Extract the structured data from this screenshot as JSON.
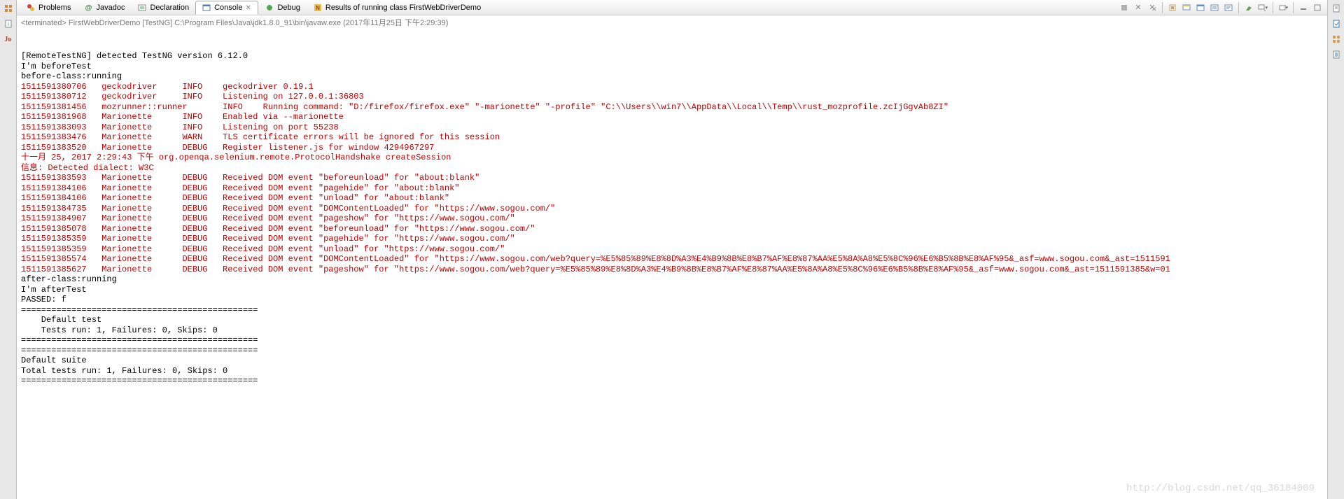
{
  "left_icons": [
    "outline-icon",
    "javadoc-icon",
    "ju-icon"
  ],
  "right_icons": [
    "outline-icon-r",
    "task-icon-r",
    "bookmark-icon-r",
    "notes-icon-r"
  ],
  "tabs": [
    {
      "label": "Problems",
      "icon": "problems-icon"
    },
    {
      "label": "Javadoc",
      "icon": "javadoc-tab-icon"
    },
    {
      "label": "Declaration",
      "icon": "declaration-icon"
    },
    {
      "label": "Console",
      "icon": "console-icon",
      "active": true,
      "closable": true
    },
    {
      "label": "Debug",
      "icon": "debug-icon"
    },
    {
      "label": "Results of running class FirstWebDriverDemo",
      "icon": "testng-icon"
    }
  ],
  "toolbar_right": [
    "terminate-icon",
    "remove-launch-icon",
    "remove-all-icon",
    "sep",
    "pin-icon",
    "display-icon",
    "open-console-icon",
    "scroll-lock-icon",
    "word-wrap-icon",
    "sep",
    "clear-icon",
    "minimize-icon",
    "sep",
    "new-console-icon",
    "sep",
    "min-view-icon",
    "max-view-icon"
  ],
  "sub_header": "<terminated> FirstWebDriverDemo [TestNG] C:\\Program Files\\Java\\jdk1.8.0_91\\bin\\javaw.exe (2017年11月25日 下午2:29:39)",
  "lines": [
    {
      "c": "black",
      "t": "[RemoteTestNG] detected TestNG version 6.12.0"
    },
    {
      "c": "black",
      "t": "I'm beforeTest"
    },
    {
      "c": "black",
      "t": "before-class:running"
    },
    {
      "c": "red",
      "t": "1511591380706   geckodriver     INFO    geckodriver 0.19.1"
    },
    {
      "c": "red",
      "t": "1511591380712   geckodriver     INFO    Listening on 127.0.0.1:36803"
    },
    {
      "c": "red",
      "t": "1511591381456   mozrunner::runner       INFO    Running command: \"D:/firefox/firefox.exe\" \"-marionette\" \"-profile\" \"C:\\\\Users\\\\win7\\\\AppData\\\\Local\\\\Temp\\\\rust_mozprofile.zcIjGgvAb8ZI\""
    },
    {
      "c": "red",
      "t": "1511591381968   Marionette      INFO    Enabled via --marionette"
    },
    {
      "c": "red",
      "t": "1511591383093   Marionette      INFO    Listening on port 55238"
    },
    {
      "c": "red",
      "t": "1511591383476   Marionette      WARN    TLS certificate errors will be ignored for this session"
    },
    {
      "c": "red",
      "t": "1511591383520   Marionette      DEBUG   Register listener.js for window 4294967297"
    },
    {
      "c": "red",
      "t": "十一月 25, 2017 2:29:43 下午 org.openqa.selenium.remote.ProtocolHandshake createSession"
    },
    {
      "c": "red",
      "t": "信息: Detected dialect: W3C"
    },
    {
      "c": "red",
      "t": "1511591383593   Marionette      DEBUG   Received DOM event \"beforeunload\" for \"about:blank\""
    },
    {
      "c": "red",
      "t": "1511591384106   Marionette      DEBUG   Received DOM event \"pagehide\" for \"about:blank\""
    },
    {
      "c": "red",
      "t": "1511591384106   Marionette      DEBUG   Received DOM event \"unload\" for \"about:blank\""
    },
    {
      "c": "red",
      "t": "1511591384735   Marionette      DEBUG   Received DOM event \"DOMContentLoaded\" for \"https://www.sogou.com/\""
    },
    {
      "c": "red",
      "t": "1511591384907   Marionette      DEBUG   Received DOM event \"pageshow\" for \"https://www.sogou.com/\""
    },
    {
      "c": "red",
      "t": "1511591385078   Marionette      DEBUG   Received DOM event \"beforeunload\" for \"https://www.sogou.com/\""
    },
    {
      "c": "red",
      "t": "1511591385359   Marionette      DEBUG   Received DOM event \"pagehide\" for \"https://www.sogou.com/\""
    },
    {
      "c": "red",
      "t": "1511591385359   Marionette      DEBUG   Received DOM event \"unload\" for \"https://www.sogou.com/\""
    },
    {
      "c": "red",
      "t": "1511591385574   Marionette      DEBUG   Received DOM event \"DOMContentLoaded\" for \"https://www.sogou.com/web?query=%E5%85%89%E8%8D%A3%E4%B9%8B%E8%B7%AF%E8%87%AA%E5%8A%A8%E5%8C%96%E6%B5%8B%E8%AF%95&_asf=www.sogou.com&_ast=1511591"
    },
    {
      "c": "red",
      "t": "1511591385627   Marionette      DEBUG   Received DOM event \"pageshow\" for \"https://www.sogou.com/web?query=%E5%85%89%E8%8D%A3%E4%B9%8B%E8%B7%AF%E8%87%AA%E5%8A%A8%E5%8C%96%E6%B5%8B%E8%AF%95&_asf=www.sogou.com&_ast=1511591385&w=01"
    },
    {
      "c": "black",
      "t": "after-class:running"
    },
    {
      "c": "black",
      "t": "I'm afterTest"
    },
    {
      "c": "black",
      "t": "PASSED: f"
    },
    {
      "c": "black",
      "t": ""
    },
    {
      "c": "black",
      "t": "==============================================="
    },
    {
      "c": "black",
      "t": "    Default test"
    },
    {
      "c": "black",
      "t": "    Tests run: 1, Failures: 0, Skips: 0"
    },
    {
      "c": "black",
      "t": "==============================================="
    },
    {
      "c": "black",
      "t": ""
    },
    {
      "c": "black",
      "t": ""
    },
    {
      "c": "black",
      "t": "==============================================="
    },
    {
      "c": "black",
      "t": "Default suite"
    },
    {
      "c": "black",
      "t": "Total tests run: 1, Failures: 0, Skips: 0"
    },
    {
      "c": "black",
      "t": "==============================================="
    }
  ],
  "watermark": "http://blog.csdn.net/qq_36184009"
}
